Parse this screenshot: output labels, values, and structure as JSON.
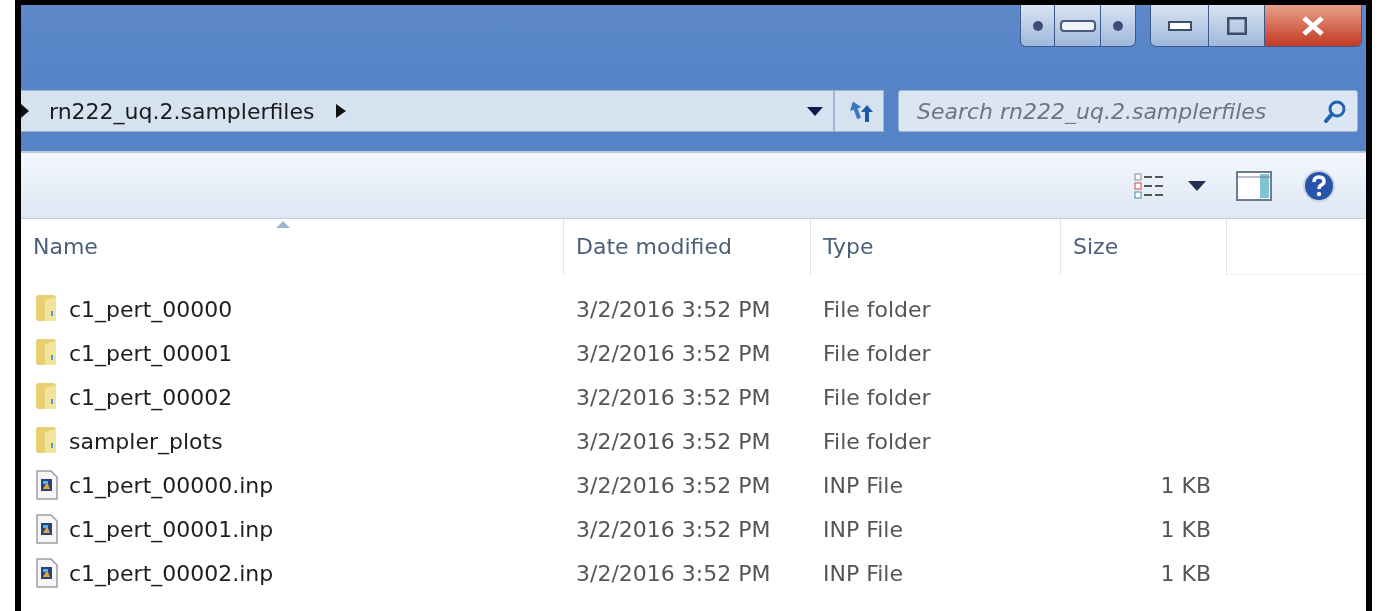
{
  "address_bar": {
    "path": "rn222_uq.2.samplerfiles"
  },
  "search": {
    "placeholder": "Search rn222_uq.2.samplerfiles"
  },
  "columns": [
    {
      "label": "Name",
      "sorted": true
    },
    {
      "label": "Date modified",
      "sorted": false
    },
    {
      "label": "Type",
      "sorted": false
    },
    {
      "label": "Size",
      "sorted": false
    }
  ],
  "rows": [
    {
      "kind": "folder",
      "name": "c1_pert_00000",
      "date": "3/2/2016 3:52 PM",
      "type": "File folder"
    },
    {
      "kind": "folder",
      "name": "c1_pert_00001",
      "date": "3/2/2016 3:52 PM",
      "type": "File folder"
    },
    {
      "kind": "folder",
      "name": "c1_pert_00002",
      "date": "3/2/2016 3:52 PM",
      "type": "File folder"
    },
    {
      "kind": "folder",
      "name": "sampler_plots",
      "date": "3/2/2016 3:52 PM",
      "type": "File folder"
    },
    {
      "kind": "file",
      "name": "c1_pert_00000.inp",
      "date": "3/2/2016 3:52 PM",
      "type": "INP File",
      "size": "1 KB"
    },
    {
      "kind": "file",
      "name": "c1_pert_00001.inp",
      "date": "3/2/2016 3:52 PM",
      "type": "INP File",
      "size": "1 KB"
    },
    {
      "kind": "file",
      "name": "c1_pert_00002.inp",
      "date": "3/2/2016 3:52 PM",
      "type": "INP File",
      "size": "1 KB"
    }
  ]
}
